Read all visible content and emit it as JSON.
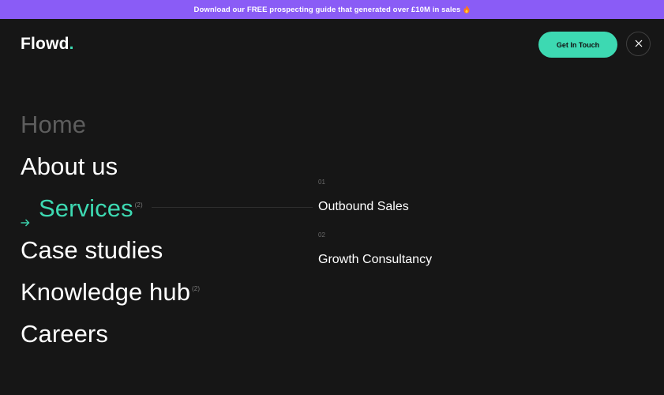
{
  "promo": {
    "text": "Download our FREE prospecting guide that generated over £10M in sales",
    "icon": "fire-icon"
  },
  "header": {
    "logo_text": "Flowd",
    "logo_dot": ".",
    "cta_label": "Get In Touch",
    "close_icon": "close-icon"
  },
  "nav": {
    "items": [
      {
        "label": "Home",
        "count": ""
      },
      {
        "label": "About us",
        "count": ""
      },
      {
        "label": "Services",
        "count": "(2)"
      },
      {
        "label": "Case studies",
        "count": ""
      },
      {
        "label": "Knowledge hub",
        "count": "(2)"
      },
      {
        "label": "Careers",
        "count": ""
      }
    ]
  },
  "services": {
    "items": [
      {
        "index": "01",
        "label": "Outbound Sales"
      },
      {
        "index": "02",
        "label": "Growth Consultancy"
      }
    ]
  },
  "colors": {
    "background": "#161616",
    "promo": "#8a5cf6",
    "accent": "#3dd9b2",
    "muted": "#5d5d5d"
  }
}
